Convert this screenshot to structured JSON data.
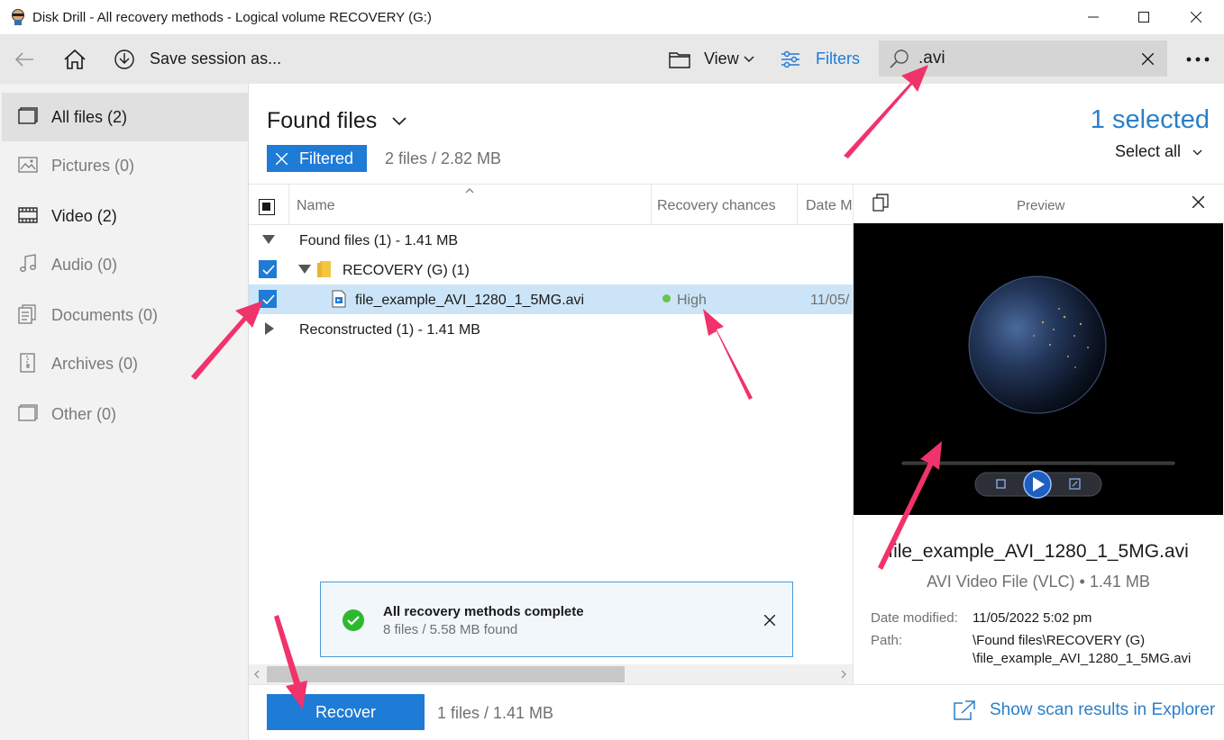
{
  "window": {
    "title": "Disk Drill - All recovery methods - Logical volume RECOVERY (G:)"
  },
  "toolbar": {
    "save_session_label": "Save session as...",
    "view_label": "View",
    "filters_label": "Filters",
    "search_value": ".avi"
  },
  "sidebar": {
    "items": [
      {
        "label": "All files (2)",
        "icon": "all-files-icon"
      },
      {
        "label": "Pictures (0)",
        "icon": "pictures-icon"
      },
      {
        "label": "Video (2)",
        "icon": "video-icon"
      },
      {
        "label": "Audio (0)",
        "icon": "audio-icon"
      },
      {
        "label": "Documents (0)",
        "icon": "documents-icon"
      },
      {
        "label": "Archives (0)",
        "icon": "archives-icon"
      },
      {
        "label": "Other (0)",
        "icon": "other-icon"
      }
    ]
  },
  "main": {
    "title": "Found files",
    "selected_count": "1 selected",
    "select_all_label": "Select all",
    "filtered_label": "Filtered",
    "filter_summary": "2 files / 2.82 MB"
  },
  "table": {
    "columns": [
      "Name",
      "Recovery chances",
      "Date M"
    ],
    "rows": {
      "group1": "Found files (1) - 1.41 MB",
      "folder": "RECOVERY (G) (1)",
      "file_name": "file_example_AVI_1280_1_5MG.avi",
      "file_chance": "High",
      "file_date": "11/05/",
      "group2": "Reconstructed (1) - 1.41 MB"
    }
  },
  "preview": {
    "title": "Preview",
    "file_name": "file_example_AVI_1280_1_5MG.avi",
    "file_info": "AVI Video File (VLC) • 1.41 MB",
    "date_label": "Date modified:",
    "date_value": "11/05/2022 5:02 pm",
    "path_label": "Path:",
    "path_line1": "\\Found files\\RECOVERY (G)",
    "path_line2": "\\file_example_AVI_1280_1_5MG.avi"
  },
  "toast": {
    "title": "All recovery methods complete",
    "subtitle": "8 files / 5.58 MB found"
  },
  "bottom": {
    "recover_label": "Recover",
    "recover_summary": "1 files / 1.41 MB",
    "explorer_link": "Show scan results in Explorer"
  },
  "colors": {
    "accent": "#1e7bd6",
    "selected_count": "#2a7fc9",
    "high_chance": "#6cc24a",
    "annotation_arrow": "#f0336a"
  }
}
